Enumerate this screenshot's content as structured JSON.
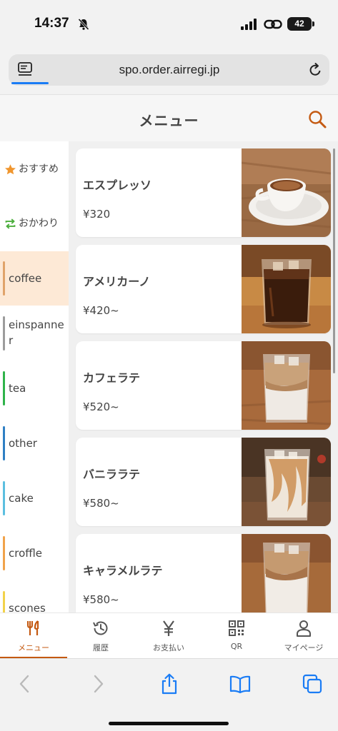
{
  "status": {
    "time": "14:37",
    "battery": "42"
  },
  "browser": {
    "url": "spo.order.airregi.jp"
  },
  "header": {
    "title": "メニュー"
  },
  "sidebar": {
    "items": [
      {
        "label": "おすすめ",
        "icon": "star-icon",
        "color": "#f0962e"
      },
      {
        "label": "おかわり",
        "icon": "repeat-icon",
        "color": "#4cae3d"
      },
      {
        "label": "coffee",
        "color": "#e0a36a",
        "active": true
      },
      {
        "label": "einspanner",
        "color": "#9c9c9c"
      },
      {
        "label": "tea",
        "color": "#2fb34a"
      },
      {
        "label": "other",
        "color": "#2f7fc4"
      },
      {
        "label": "cake",
        "color": "#5bbfe0"
      },
      {
        "label": "croffle",
        "color": "#f0a24a"
      },
      {
        "label": "scones",
        "color": "#f2d24a"
      }
    ]
  },
  "menu": {
    "items": [
      {
        "name": "エスプレッソ",
        "price": "¥320",
        "photo": "espresso-photo"
      },
      {
        "name": "アメリカーノ",
        "price": "¥420~",
        "photo": "americano-photo"
      },
      {
        "name": "カフェラテ",
        "price": "¥520~",
        "photo": "cafe-latte-photo"
      },
      {
        "name": "バニララテ",
        "price": "¥580~",
        "photo": "vanilla-latte-photo"
      },
      {
        "name": "キャラメルラテ",
        "price": "¥580~",
        "photo": "caramel-latte-photo"
      }
    ]
  },
  "bottom_nav": {
    "items": [
      {
        "label": "メニュー",
        "icon": "utensils-icon",
        "active": true
      },
      {
        "label": "履歴",
        "icon": "history-icon"
      },
      {
        "label": "お支払い",
        "icon": "yen-icon"
      },
      {
        "label": "QR",
        "icon": "qr-code-icon"
      },
      {
        "label": "マイページ",
        "icon": "user-icon"
      }
    ]
  },
  "colors": {
    "accent": "#c45a12",
    "active_bg": "#fde9d6",
    "ios_blue": "#1a7cf5"
  }
}
